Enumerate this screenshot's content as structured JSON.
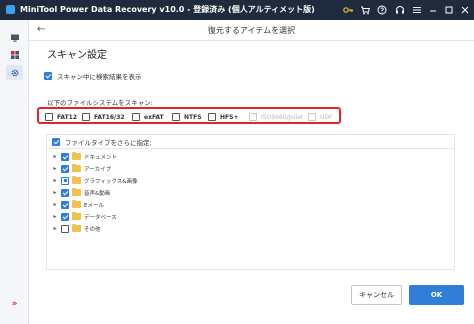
{
  "window": {
    "title": "MiniTool Power Data Recovery v10.0 - 登録済み (個人アルティメット版)",
    "accent_color": "#2f7fd8",
    "highlight_color": "#e0262b",
    "titlebar_icons": [
      "key-icon",
      "upgrade-cart-icon",
      "help-icon",
      "headset-icon",
      "menu-icon",
      "minimize-icon",
      "maximize-icon",
      "close-icon"
    ]
  },
  "sidebar": {
    "items": [
      {
        "icon": "monitor-icon"
      },
      {
        "icon": "apps-icon"
      },
      {
        "icon": "gear-icon",
        "active": true
      }
    ],
    "expand_icon": "double-chevron-right-icon"
  },
  "header": {
    "title": "復元するアイテムを選択"
  },
  "scan_settings": {
    "title": "スキャン設定",
    "show_results_label": "スキャン中に検索結果を表示",
    "show_results_checked": true
  },
  "filesystems": {
    "label": "以下のファイルシステムをスキャン:",
    "items": [
      {
        "label": "FAT12",
        "checked": false,
        "enabled": true
      },
      {
        "label": "FAT16/32",
        "checked": false,
        "enabled": true
      },
      {
        "label": "exFAT",
        "checked": false,
        "enabled": true
      },
      {
        "label": "NTFS",
        "checked": false,
        "enabled": true
      },
      {
        "label": "HFS+",
        "checked": false,
        "enabled": true
      },
      {
        "label": "ISO9660/Joliet",
        "checked": false,
        "enabled": false
      },
      {
        "label": "UDF",
        "checked": false,
        "enabled": false
      }
    ]
  },
  "file_types": {
    "header_label": "ファイルタイプをさらに指定:",
    "header_checked": true,
    "items": [
      {
        "label": "ドキュメント",
        "state": "checked"
      },
      {
        "label": "アーカイブ",
        "state": "checked"
      },
      {
        "label": "グラフィックス&画像",
        "state": "partial"
      },
      {
        "label": "音声&動画",
        "state": "checked"
      },
      {
        "label": "Eメール",
        "state": "checked"
      },
      {
        "label": "データベース",
        "state": "checked"
      },
      {
        "label": "その他",
        "state": "unchecked"
      }
    ]
  },
  "buttons": {
    "cancel_label": "キャンセル",
    "ok_label": "OK"
  }
}
